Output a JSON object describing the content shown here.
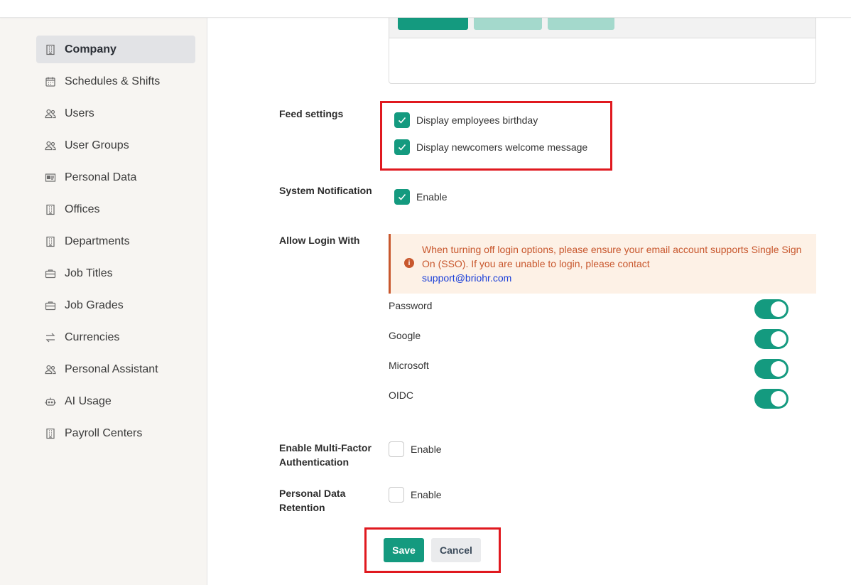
{
  "sidebar": {
    "items": [
      {
        "label": "Company",
        "icon": "building-icon",
        "active": true
      },
      {
        "label": "Schedules & Shifts",
        "icon": "calendar-icon"
      },
      {
        "label": "Users",
        "icon": "users-icon"
      },
      {
        "label": "User Groups",
        "icon": "users-icon"
      },
      {
        "label": "Personal Data",
        "icon": "id-card-icon"
      },
      {
        "label": "Offices",
        "icon": "building-icon"
      },
      {
        "label": "Departments",
        "icon": "building-icon"
      },
      {
        "label": "Job Titles",
        "icon": "briefcase-icon"
      },
      {
        "label": "Job Grades",
        "icon": "briefcase-icon"
      },
      {
        "label": "Currencies",
        "icon": "exchange-icon"
      },
      {
        "label": "Personal Assistant",
        "icon": "users-icon"
      },
      {
        "label": "AI Usage",
        "icon": "robot-icon"
      },
      {
        "label": "Payroll Centers",
        "icon": "building-icon"
      }
    ]
  },
  "feed_settings": {
    "label": "Feed settings",
    "options": [
      {
        "label": "Display employees birthday",
        "checked": true
      },
      {
        "label": "Display newcomers welcome message",
        "checked": true
      }
    ]
  },
  "system_notification": {
    "label": "System Notification",
    "option": "Enable",
    "checked": true
  },
  "allow_login": {
    "label": "Allow Login With",
    "alert": {
      "text": "When turning off login options, please ensure your email account supports Single Sign On (SSO). If you are unable to login, please contact",
      "link": "support@briohr.com"
    },
    "options": [
      {
        "label": "Password",
        "enabled": true
      },
      {
        "label": "Google",
        "enabled": true
      },
      {
        "label": "Microsoft",
        "enabled": true
      },
      {
        "label": "OIDC",
        "enabled": true
      }
    ]
  },
  "mfa": {
    "label_line1": "Enable Multi-Factor",
    "label_line2": "Authentication",
    "option": "Enable",
    "checked": false
  },
  "retention": {
    "label_line1": "Personal Data",
    "label_line2": "Retention",
    "option": "Enable",
    "checked": false
  },
  "actions": {
    "save": "Save",
    "cancel": "Cancel"
  },
  "colors": {
    "accent": "#149a7f",
    "alert_text": "#c8572d",
    "alert_bg": "#fdf1e6",
    "highlight": "#e0191f",
    "link": "#1a3fd8"
  }
}
